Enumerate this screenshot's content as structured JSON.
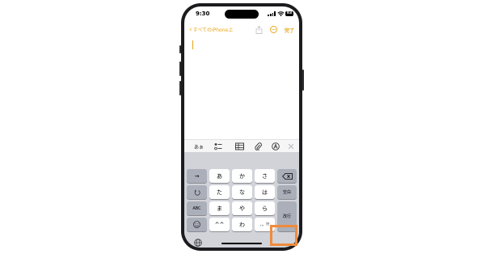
{
  "status_bar": {
    "time": "9:30",
    "battery": "83"
  },
  "nav": {
    "back_label": "すべてのiPhone上",
    "done_label": "完了"
  },
  "colors": {
    "accent": "#e8a317",
    "highlight": "#f08b3c"
  },
  "toolbar": {
    "format_label": "あぁ",
    "icons": [
      "checklist-icon",
      "table-icon",
      "paperclip-icon",
      "markup-icon",
      "close-icon"
    ]
  },
  "keyboard": {
    "row1": {
      "left": "→",
      "keys": [
        "あ",
        "か",
        "さ"
      ],
      "right_icon": "delete-icon"
    },
    "row2": {
      "left_icon": "undo-icon",
      "keys": [
        "た",
        "な",
        "は"
      ],
      "right": "空白"
    },
    "row3": {
      "left": "ABC",
      "keys": [
        "ま",
        "や",
        "ら"
      ],
      "right": "改行"
    },
    "row4": {
      "left_icon": "emoji-icon",
      "keys": [
        "^^",
        "わ",
        "、。?!"
      ]
    },
    "bottom_left_icon": "globe-icon"
  }
}
